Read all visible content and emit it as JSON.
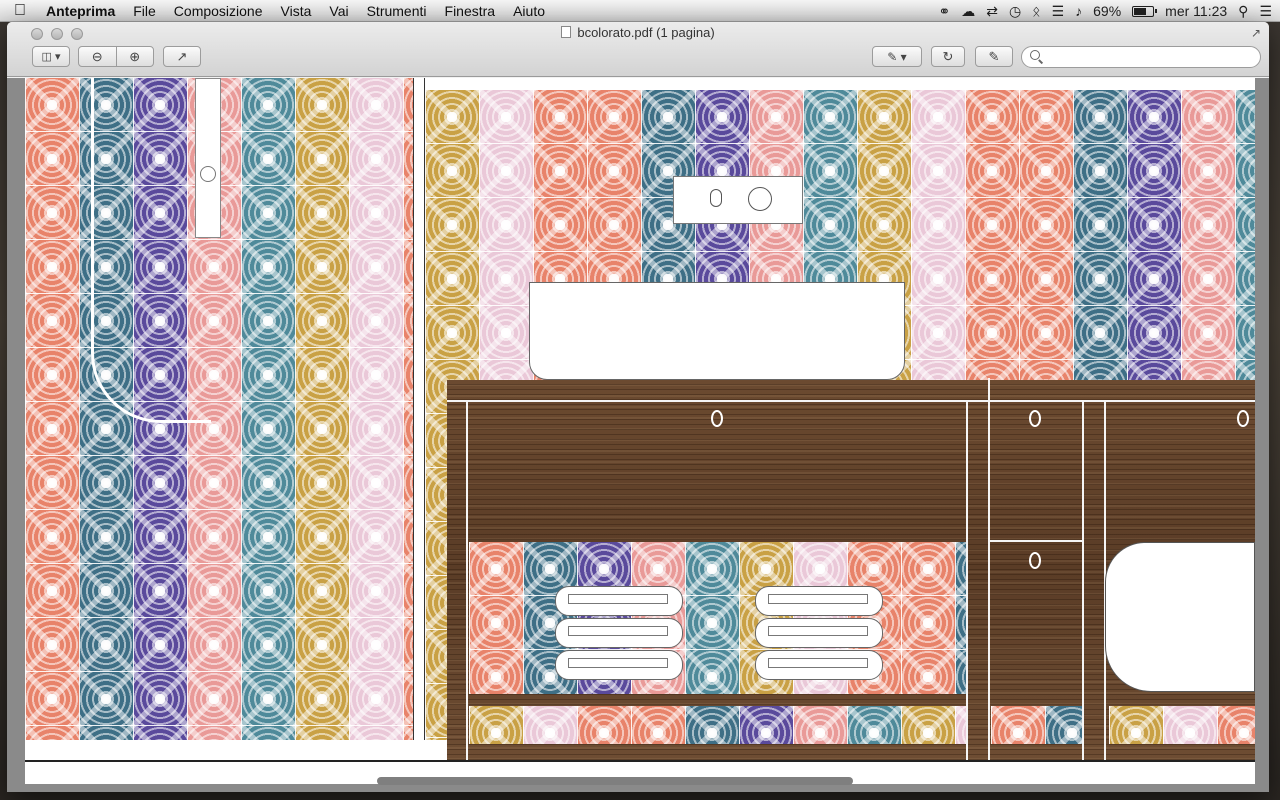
{
  "menubar": {
    "apple_icon": "apple-icon",
    "items": [
      "Anteprima",
      "File",
      "Composizione",
      "Vista",
      "Vai",
      "Strumenti",
      "Finestra",
      "Aiuto"
    ],
    "battery_percent": "69%",
    "clock": "mer 11:23",
    "status_icons": [
      "creative-cloud-icon",
      "icloud-icon",
      "sync-icon",
      "time-machine-icon",
      "bluetooth-icon",
      "wifi-icon",
      "volume-icon",
      "battery-icon",
      "spotlight-icon",
      "notification-center-icon"
    ]
  },
  "window": {
    "title": "bcolorato.pdf (1 pagina)",
    "search_placeholder": ""
  },
  "toolbar": {
    "icons": [
      "sidebar-view-icon",
      "zoom-out-icon",
      "zoom-in-icon",
      "share-icon",
      "annotate-icon",
      "rotate-icon",
      "edit-icon"
    ]
  }
}
